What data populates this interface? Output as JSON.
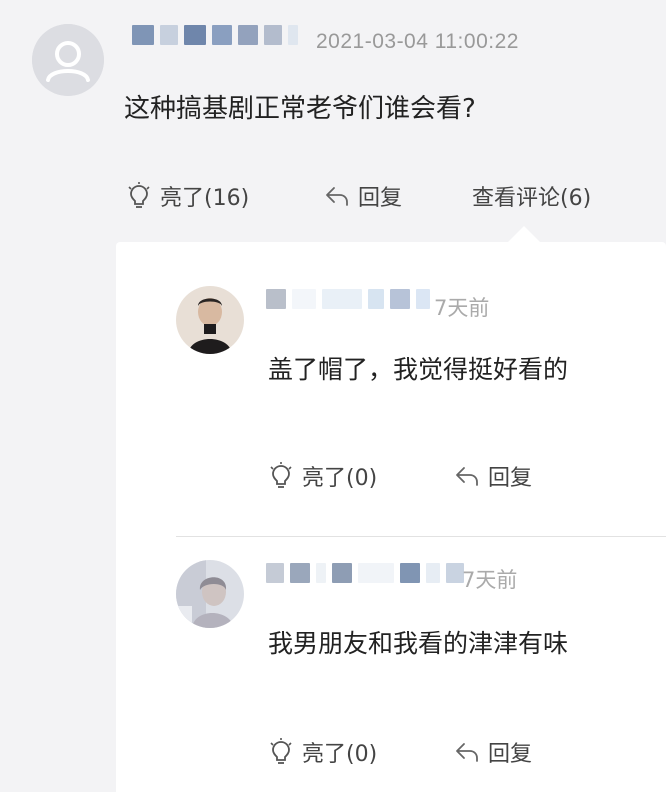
{
  "main_comment": {
    "timestamp": "2021-03-04 11:00:22",
    "text": "这种搞基剧正常老爷们谁会看?",
    "actions": {
      "like_label": "亮了(16)",
      "reply_label": "回复",
      "view_replies_label": "查看评论(6)"
    }
  },
  "replies": [
    {
      "time": "7天前",
      "text": "盖了帽了，我觉得挺好看的",
      "like_label": "亮了(0)",
      "reply_label": "回复"
    },
    {
      "time": "7天前",
      "text": "我男朋友和我看的津津有味",
      "like_label": "亮了(0)",
      "reply_label": "回复"
    }
  ],
  "icons": {
    "avatar": "user-silhouette-icon",
    "like": "lightbulb-icon",
    "reply": "reply-arrow-icon"
  },
  "colors": {
    "background": "#f3f3f5",
    "panel": "#ffffff",
    "meta_text": "#999999",
    "blur_blue": "#7f95b6"
  }
}
